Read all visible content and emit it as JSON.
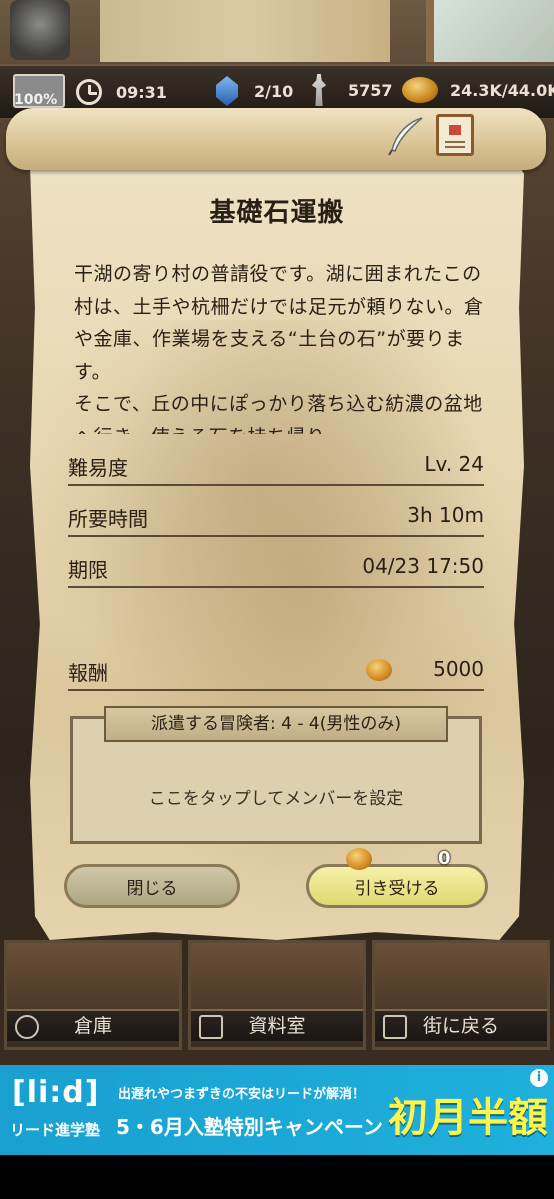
{
  "status": {
    "battery": "100%",
    "time": "09:31",
    "gems": "2/10",
    "fame": "5757",
    "gold": "24.3K/44.0K"
  },
  "quest": {
    "title": "基礎石運搬",
    "description": "干湖の寄り村の普請役です。湖に囲まれたこの村は、土手や杭柵だけでは足元が頼りない。倉や金庫、作業場を支える“土台の石”が要ります。\nそこで、丘の中にぽっかり落ち込む紡濃の盆地へ行き、使える石を持ち帰り",
    "rows": [
      {
        "label": "難易度",
        "value": "Lv. 24"
      },
      {
        "label": "所要時間",
        "value": "3h 10m"
      },
      {
        "label": "期限",
        "value": "04/23 17:50"
      }
    ],
    "reward_label": "報酬",
    "reward_value": "5000",
    "party_label": "派遣する冒険者: 4 - 4(男性のみ)",
    "party_hint": "ここをタップしてメンバーを設定",
    "close_label": "閉じる",
    "accept_label": "引き受ける",
    "accept_cost": "0"
  },
  "menu": {
    "items": [
      {
        "label": "倉庫",
        "icon": "building-icon"
      },
      {
        "label": "資料室",
        "icon": "book-icon"
      },
      {
        "label": "街に戻る",
        "icon": "door-icon"
      }
    ]
  },
  "ad": {
    "logo": "[li:d]",
    "logo_sub": "リード進学塾",
    "line1": "出遅れやつまずきの不安はリードが解消！",
    "line2": "5・6月入塾特別キャンペーン",
    "big": "初月半額",
    "info": "i"
  }
}
